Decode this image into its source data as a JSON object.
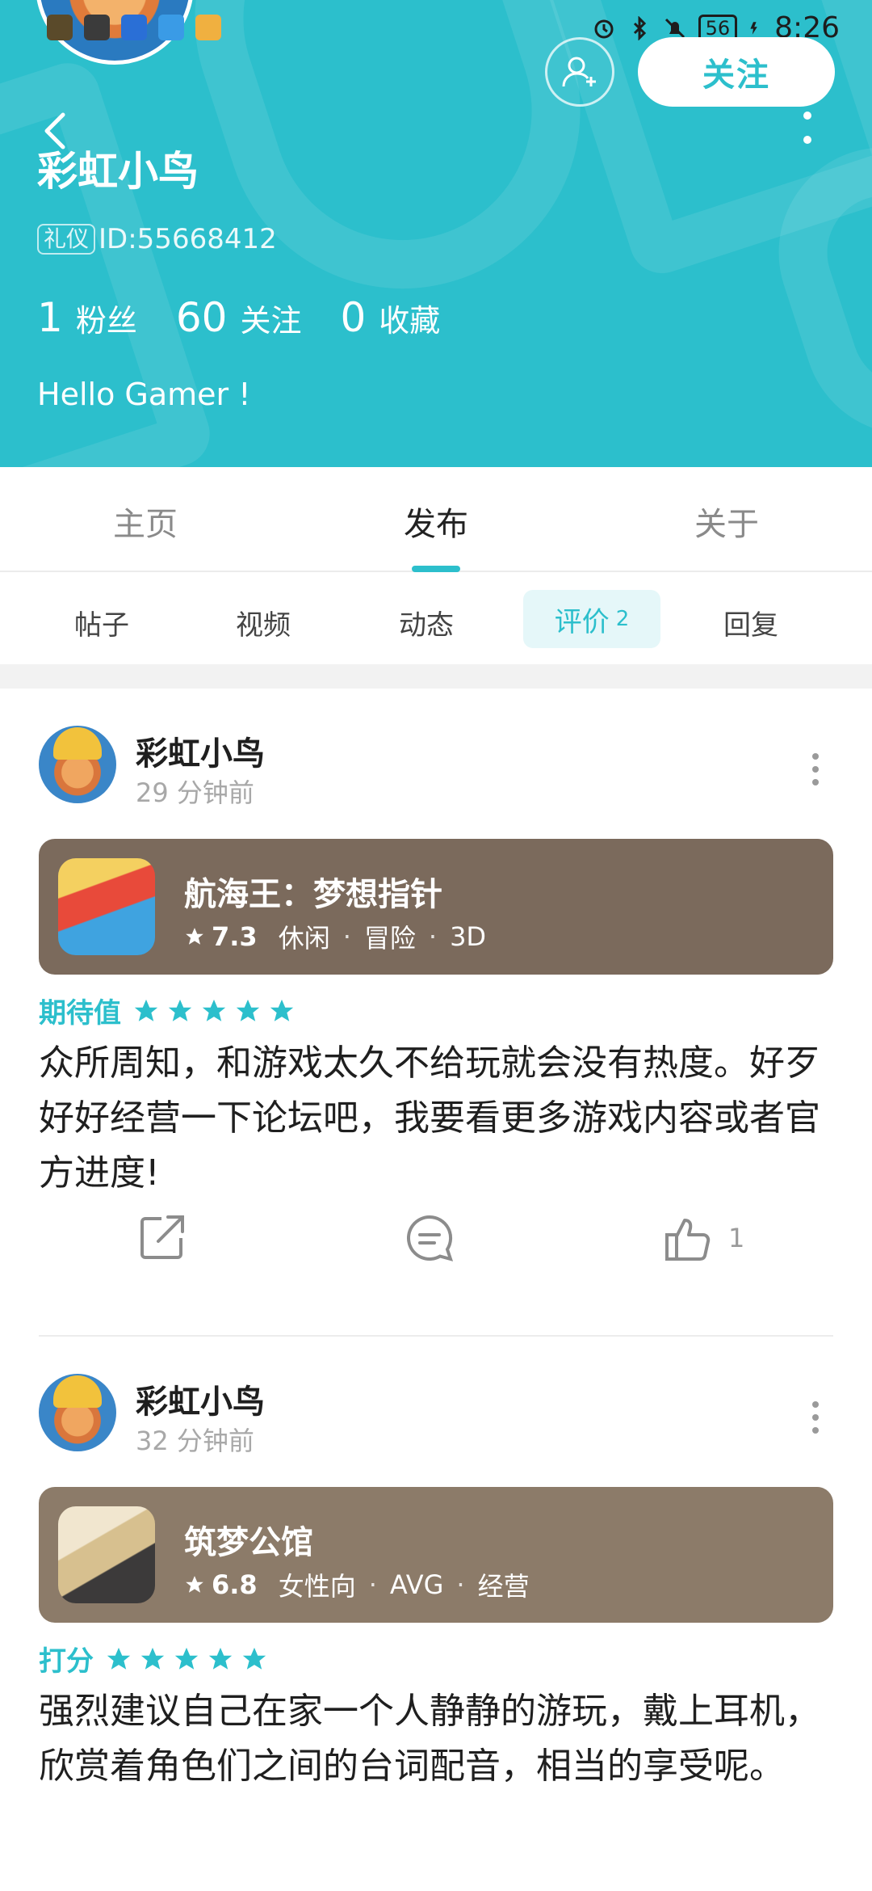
{
  "status_bar": {
    "time": "8:26",
    "battery": "56"
  },
  "profile": {
    "username": "彩虹小鸟",
    "badge": "礼仪",
    "id_text": "ID:55668412",
    "bio": "Hello Gamer !",
    "follow_label": "关注",
    "stats": [
      {
        "num": "1",
        "label": "粉丝"
      },
      {
        "num": "60",
        "label": "关注"
      },
      {
        "num": "0",
        "label": "收藏"
      }
    ]
  },
  "main_tabs": [
    "主页",
    "发布",
    "关于"
  ],
  "sub_tabs": {
    "items": [
      "帖子",
      "视频",
      "动态",
      "回复"
    ],
    "active_label": "评价",
    "active_count": "2"
  },
  "posts": [
    {
      "user": "彩虹小鸟",
      "time": "29 分钟前",
      "game": {
        "name": "航海王：梦想指针",
        "score": "7.3",
        "tags": [
          "休闲",
          "冒险",
          "3D"
        ],
        "card_color": "#7b6a5c"
      },
      "rating_label": "期待值",
      "stars": 5,
      "body": "众所周知，和游戏太久不给玩就会没有热度。好歹好好经营一下论坛吧，我要看更多游戏内容或者官方进度!",
      "like_count": "1"
    },
    {
      "user": "彩虹小鸟",
      "time": "32 分钟前",
      "game": {
        "name": "筑梦公馆",
        "score": "6.8",
        "tags": [
          "女性向",
          "AVG",
          "经营"
        ],
        "card_color": "#8c7b69"
      },
      "rating_label": "打分",
      "stars": 5,
      "body": "强烈建议自己在家一个人静静的游玩，戴上耳机，欣赏着角色们之间的台词配音，相当的享受呢。"
    }
  ],
  "colors": {
    "accent": "#2cbfcc",
    "header_bg": "#2cbfcc"
  }
}
